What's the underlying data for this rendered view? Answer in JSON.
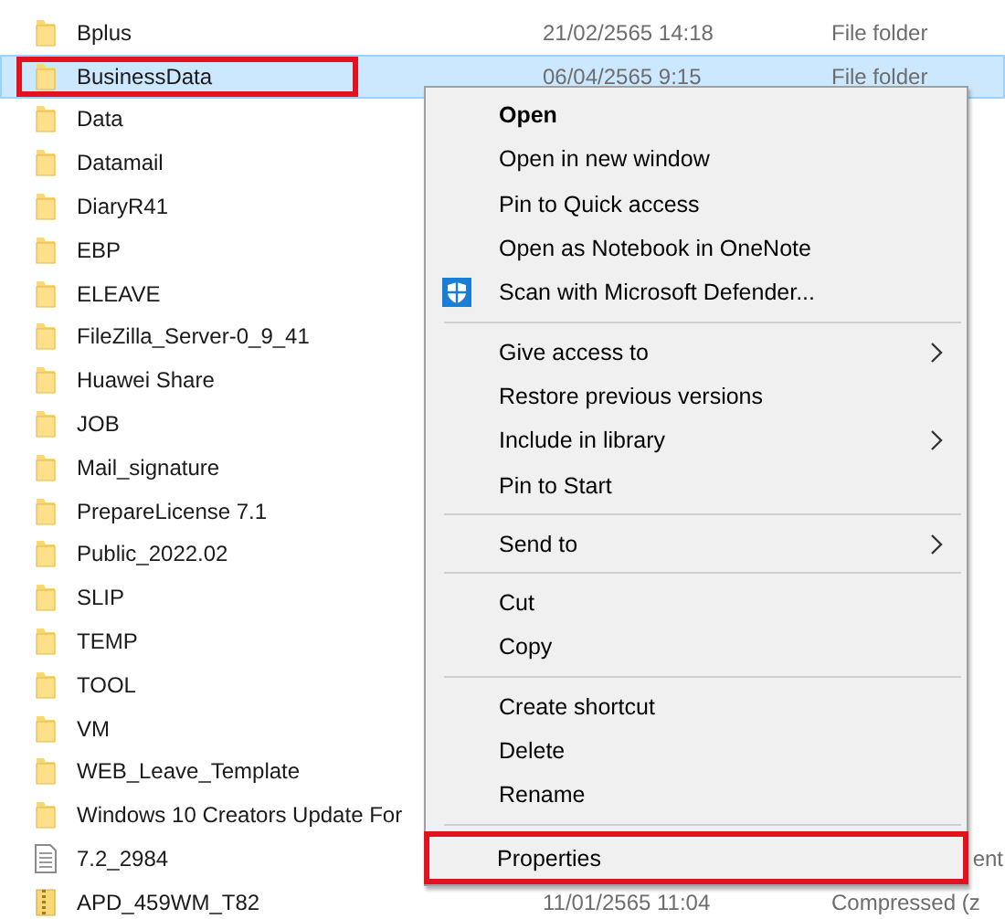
{
  "files": [
    {
      "name": "Bplus",
      "kind": "folder",
      "date": "21/02/2565 14:18",
      "type": "File folder",
      "selected": false,
      "highlighted": false
    },
    {
      "name": "BusinessData",
      "kind": "folder",
      "date": "06/04/2565 9:15",
      "type": "File folder",
      "selected": true,
      "highlighted": true
    },
    {
      "name": "Data",
      "kind": "folder",
      "selected": false,
      "highlighted": false
    },
    {
      "name": "Datamail",
      "kind": "folder",
      "selected": false,
      "highlighted": false
    },
    {
      "name": "DiaryR41",
      "kind": "folder",
      "selected": false,
      "highlighted": false
    },
    {
      "name": "EBP",
      "kind": "folder",
      "selected": false,
      "highlighted": false
    },
    {
      "name": "ELEAVE",
      "kind": "folder",
      "selected": false,
      "highlighted": false
    },
    {
      "name": "FileZilla_Server-0_9_41",
      "kind": "folder",
      "selected": false,
      "highlighted": false
    },
    {
      "name": "Huawei Share",
      "kind": "folder",
      "selected": false,
      "highlighted": false
    },
    {
      "name": "JOB",
      "kind": "folder",
      "selected": false,
      "highlighted": false
    },
    {
      "name": "Mail_signature",
      "kind": "folder",
      "selected": false,
      "highlighted": false
    },
    {
      "name": "PrepareLicense 7.1",
      "kind": "folder",
      "selected": false,
      "highlighted": false
    },
    {
      "name": "Public_2022.02",
      "kind": "folder",
      "selected": false,
      "highlighted": false
    },
    {
      "name": "SLIP",
      "kind": "folder",
      "selected": false,
      "highlighted": false
    },
    {
      "name": "TEMP",
      "kind": "folder",
      "selected": false,
      "highlighted": false
    },
    {
      "name": "TOOL",
      "kind": "folder",
      "selected": false,
      "highlighted": false
    },
    {
      "name": "VM",
      "kind": "folder",
      "selected": false,
      "highlighted": false
    },
    {
      "name": "WEB_Leave_Template",
      "kind": "folder",
      "selected": false,
      "highlighted": false
    },
    {
      "name": "Windows 10 Creators Update For",
      "kind": "folder",
      "selected": false,
      "highlighted": false
    },
    {
      "name": "7.2_2984",
      "kind": "document",
      "type": "ent",
      "selected": false,
      "highlighted": false
    },
    {
      "name": "APD_459WM_T82",
      "kind": "zip",
      "date": "11/01/2565 11:04",
      "type": "Compressed (z",
      "selected": false,
      "highlighted": false
    }
  ],
  "context_menu": {
    "groups": [
      {
        "items": [
          {
            "label": "Open",
            "kind": "plain",
            "default": true,
            "submenu": false,
            "highlighted": false
          },
          {
            "label": "Open in new window",
            "kind": "plain",
            "default": false,
            "submenu": false,
            "highlighted": false
          },
          {
            "label": "Pin to Quick access",
            "kind": "plain",
            "default": false,
            "submenu": false,
            "highlighted": false
          },
          {
            "label": "Open as Notebook in OneNote",
            "kind": "plain",
            "default": false,
            "submenu": false,
            "highlighted": false
          },
          {
            "label": "Scan with Microsoft Defender...",
            "kind": "shield",
            "default": false,
            "submenu": false,
            "highlighted": false
          }
        ]
      },
      {
        "items": [
          {
            "label": "Give access to",
            "kind": "plain",
            "default": false,
            "submenu": true,
            "highlighted": false
          },
          {
            "label": "Restore previous versions",
            "kind": "plain",
            "default": false,
            "submenu": false,
            "highlighted": false
          },
          {
            "label": "Include in library",
            "kind": "plain",
            "default": false,
            "submenu": true,
            "highlighted": false
          },
          {
            "label": "Pin to Start",
            "kind": "plain",
            "default": false,
            "submenu": false,
            "highlighted": false
          }
        ]
      },
      {
        "items": [
          {
            "label": "Send to",
            "kind": "plain",
            "default": false,
            "submenu": true,
            "highlighted": false
          }
        ]
      },
      {
        "items": [
          {
            "label": "Cut",
            "kind": "plain",
            "default": false,
            "submenu": false,
            "highlighted": false
          },
          {
            "label": "Copy",
            "kind": "plain",
            "default": false,
            "submenu": false,
            "highlighted": false
          }
        ]
      },
      {
        "items": [
          {
            "label": "Create shortcut",
            "kind": "plain",
            "default": false,
            "submenu": false,
            "highlighted": false
          },
          {
            "label": "Delete",
            "kind": "plain",
            "default": false,
            "submenu": false,
            "highlighted": false
          },
          {
            "label": "Rename",
            "kind": "plain",
            "default": false,
            "submenu": false,
            "highlighted": false
          }
        ]
      },
      {
        "items": [
          {
            "label": "Properties",
            "kind": "plain",
            "default": false,
            "submenu": false,
            "highlighted": true
          }
        ]
      }
    ]
  }
}
